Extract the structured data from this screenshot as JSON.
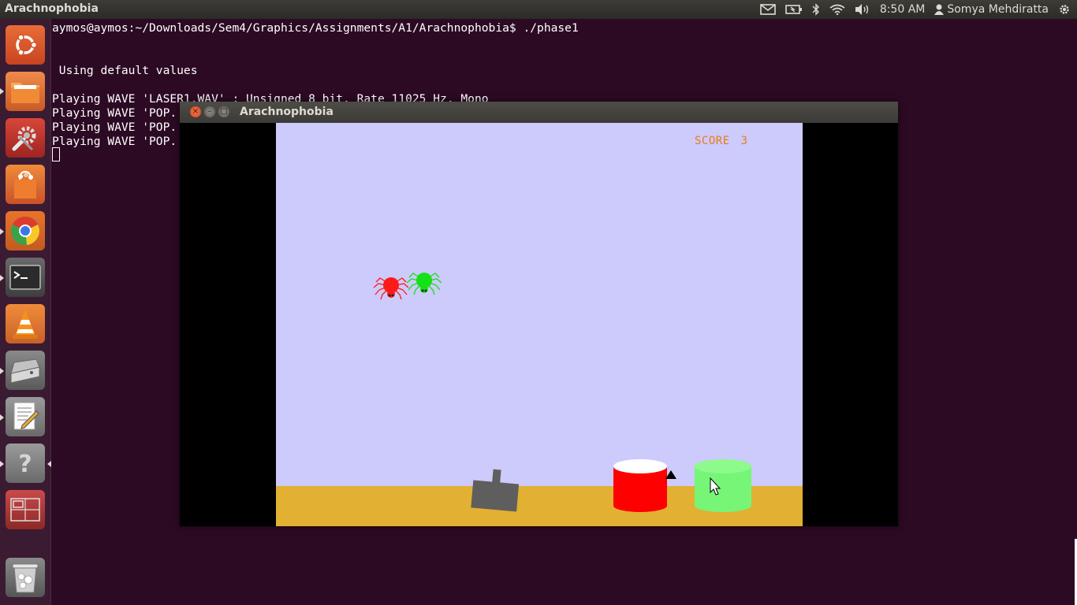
{
  "panel": {
    "app_title": "Arachnophobia",
    "time": "8:50 AM",
    "user": "Somya Mehdiratta",
    "icons": [
      "mail-icon",
      "battery-icon",
      "bluetooth-icon",
      "wifi-icon",
      "volume-icon",
      "user-icon",
      "gear-icon"
    ]
  },
  "launcher": {
    "items": [
      {
        "name": "dash-home",
        "icon": "ubuntu-logo-icon",
        "color": "#e05a2b"
      },
      {
        "name": "files",
        "icon": "folder-icon",
        "color": "#e8742b"
      },
      {
        "name": "system-settings",
        "icon": "settings-icon",
        "color": "#c9342b"
      },
      {
        "name": "software-center",
        "icon": "shopping-bag-icon",
        "color": "#e86c2a"
      },
      {
        "name": "chrome",
        "icon": "chrome-icon",
        "color": "#dd6a2b"
      },
      {
        "name": "terminal",
        "icon": "terminal-icon",
        "color": "#5b5b5b"
      },
      {
        "name": "vlc",
        "icon": "vlc-cone-icon",
        "color": "#e07a2a"
      },
      {
        "name": "scanner",
        "icon": "scanner-icon",
        "color": "#7a7a7a"
      },
      {
        "name": "text-editor",
        "icon": "text-editor-icon",
        "color": "#8a8a8a"
      },
      {
        "name": "help",
        "icon": "help-icon",
        "color": "#8a8a8a"
      },
      {
        "name": "workspace-switcher",
        "icon": "workspace-icon",
        "color": "#b53a3a"
      },
      {
        "name": "trash",
        "icon": "trash-icon",
        "color": "#7a7a7a"
      }
    ]
  },
  "terminal": {
    "prompt_line": "aymos@aymos:~/Downloads/Sem4/Graphics/Assignments/A1/Arachnophobia$ ./phase1",
    "lines": [
      " Using default values",
      "Playing WAVE 'LASER1.WAV' : Unsigned 8 bit, Rate 11025 Hz, Mono",
      "Playing WAVE 'POP.",
      "Playing WAVE 'POP.",
      "Playing WAVE 'POP."
    ]
  },
  "game_window": {
    "title": "Arachnophobia",
    "close": "×",
    "minimize": "–",
    "maximize": "□",
    "score_label": "SCORE",
    "score_value": "3",
    "colors": {
      "sky": "#cccbfb",
      "ground": "#e2b032",
      "red_spider": "#ff1a1a",
      "green_spider": "#16e016",
      "red_basket": "#ff0000",
      "green_basket": "#77f577",
      "cannon": "#5e5e5e",
      "score_text": "#e87a1a"
    }
  }
}
